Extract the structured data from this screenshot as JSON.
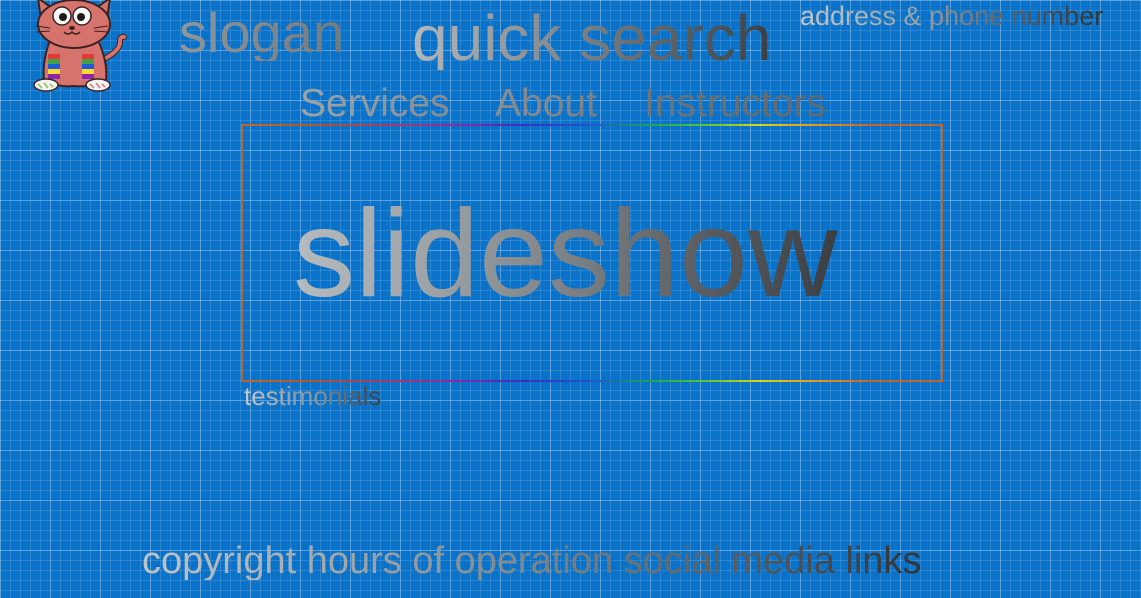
{
  "header": {
    "slogan": "slogan",
    "quick_search": "quick search",
    "contact": "address & phone number"
  },
  "nav": {
    "items": [
      {
        "label": "Services"
      },
      {
        "label": "About"
      },
      {
        "label": "Instructors"
      }
    ]
  },
  "main": {
    "slideshow_label": "slideshow",
    "testimonials_label": "testimonials"
  },
  "footer": {
    "text": "copyright hours of operation social media links"
  },
  "icons": {
    "logo": "cat-mascot-icon"
  },
  "colors": {
    "background": "#0a73c9",
    "frame_border": "#b5682f"
  }
}
